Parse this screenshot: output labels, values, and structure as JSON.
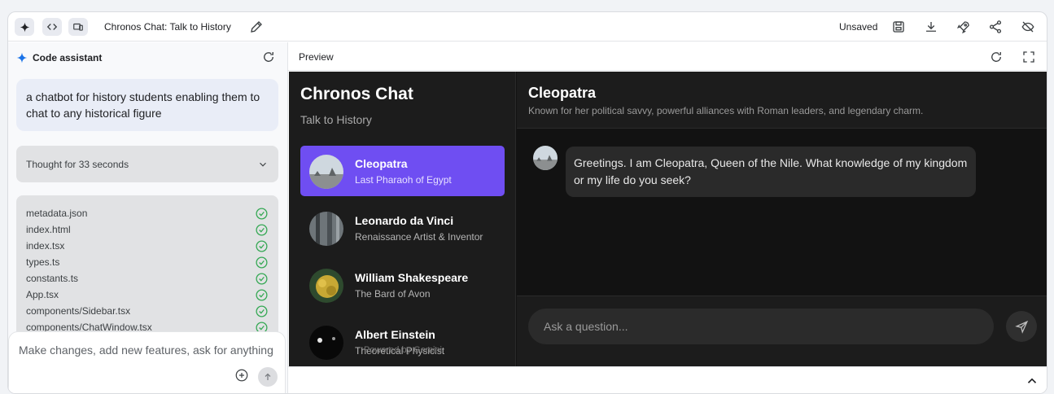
{
  "topbar": {
    "title": "Chronos Chat: Talk to History",
    "status": "Unsaved"
  },
  "assistant": {
    "header": "Code assistant",
    "prompt": "a chatbot for history students enabling them to chat to any historical figure",
    "thought": "Thought for 33 seconds",
    "files": [
      "metadata.json",
      "index.html",
      "index.tsx",
      "types.ts",
      "constants.ts",
      "App.tsx",
      "components/Sidebar.tsx",
      "components/ChatWindow.tsx"
    ],
    "input_placeholder": "Make changes, add new features, ask for anything"
  },
  "preview": {
    "label": "Preview"
  },
  "app": {
    "title": "Chronos Chat",
    "subtitle": "Talk to History",
    "figures": [
      {
        "name": "Cleopatra",
        "desc": "Last Pharaoh of Egypt"
      },
      {
        "name": "Leonardo da Vinci",
        "desc": "Renaissance Artist & Inventor"
      },
      {
        "name": "William Shakespeare",
        "desc": "The Bard of Avon"
      },
      {
        "name": "Albert Einstein",
        "desc": "Theoretical Physicist"
      }
    ],
    "powered": "Powered by Gemini",
    "chat": {
      "name": "Cleopatra",
      "desc": "Known for her political savvy, powerful alliances with Roman leaders, and legendary charm.",
      "message": "Greetings. I am Cleopatra, Queen of the Nile. What knowledge of my kingdom or my life do you seek?",
      "input_placeholder": "Ask a question..."
    }
  },
  "colors": {
    "accent": "#6f4ef2",
    "check": "#34a853",
    "spark": "#1a73e8"
  }
}
